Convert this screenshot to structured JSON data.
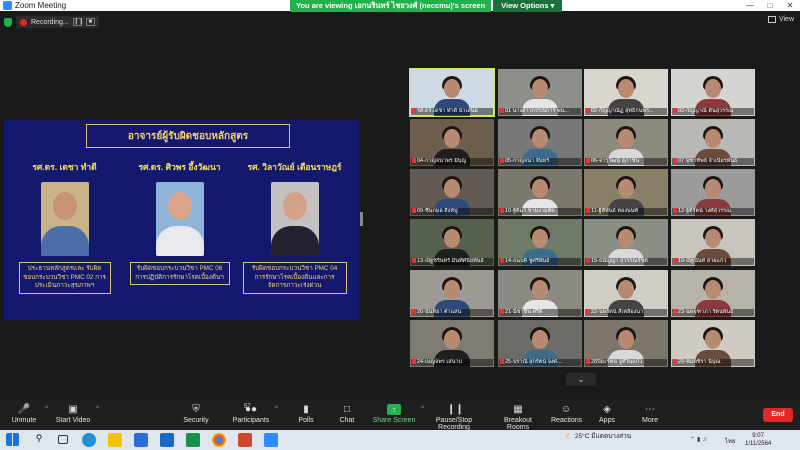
{
  "window": {
    "title": "Zoom Meeting"
  },
  "share_banner": {
    "message": "You are viewing เอกนรินทร์ ไชยวงศ์ (neccmu)'s screen",
    "options_label": "View Options ▾"
  },
  "recording": {
    "label": "Recording..."
  },
  "view_label": "View",
  "slide": {
    "title": "อาจารย์ผู้รับผิดชอบหลักสูตร",
    "professors": [
      {
        "name": "รศ.ดร. เดชา ทำดี",
        "desc": "ประธานหลักสูตรและ รับผิดชอบกระบวนวิชา PMC 02 การประเมินภาวะสุขภาพฯ",
        "shirt": "#4c6ea8",
        "bg": "#c9b48a"
      },
      {
        "name": "รศ.ดร. ศิวพร อึ้งวัฒนา",
        "desc": "รับผิดชอบกระบวนวิชา PMC 06 การปฏิบัติการรักษาโรคเบื้องต้นฯ",
        "shirt": "#e8e8ef",
        "bg": "#8fb4d8"
      },
      {
        "name": "รศ. วิลาวัณย์ เตือนราษฎร์",
        "desc": "รับผิดชอบกระบวนวิชา PMC 04 การรักษาโรคเบื้องต้นและการ จัดการภาวะเร่งด่วน",
        "shirt": "#222233",
        "bg": "#c4c2c0"
      }
    ]
  },
  "participants": [
    {
      "label": "รศ.ดร.เดชา ทำดี นำเสนอ",
      "bg": "#cfd9e4"
    },
    {
      "label": "01 นางสาวกรรณิการ์ พน...",
      "bg": "#8c8f8a"
    },
    {
      "label": "02-กัญญาณัฏ สุทธิกนพร...",
      "bg": "#d8d6cf"
    },
    {
      "label": "03-กัญญาณี ตันสุวรรณ",
      "bg": "#d4d4d0"
    },
    {
      "label": "04-กาญจนาพร มีบุญ",
      "bg": "#6d5d4c"
    },
    {
      "label": "05-กาญจนา จันทร์",
      "bg": "#78787a"
    },
    {
      "label": "06-จารุวัฒน์ สุภาชน",
      "bg": "#8e8a7e"
    },
    {
      "label": "07 จุฑาทิพย์ จำเนียรพันธ์",
      "bg": "#b8b8b4"
    },
    {
      "label": "09-ชื่นกมล สิงห์ปู",
      "bg": "#625a54"
    },
    {
      "label": "10-ฐิติมา ขามงามตัด",
      "bg": "#7d786d"
    },
    {
      "label": "11-ฐิติพันธ์ ทองนนท์",
      "bg": "#877f66"
    },
    {
      "label": "12-ฐิติรัตน์ วงศ์สุวรรณ",
      "bg": "#9b9b9b"
    },
    {
      "label": "13-ณัฐชรินทร์ มันทัศนียพันธ์",
      "bg": "#57624e"
    },
    {
      "label": "14-ธนบดี ชูศรีพันธ์",
      "bg": "#6f7b66"
    },
    {
      "label": "15-ธนัญญา สุวรรณรัชต์",
      "bg": "#8a8f86"
    },
    {
      "label": "19-ณัฐนันท์ สายแก้ว",
      "bg": "#c8c5bf"
    },
    {
      "label": "20-นันทิยา ตำแสน",
      "bg": "#9c9a93"
    },
    {
      "label": "21-นิชาชิน ศรีดี",
      "bg": "#8b8a82"
    },
    {
      "label": "22-นพรัตน์ สีเหลืองนา",
      "bg": "#d0cdc5"
    },
    {
      "label": "23-นพจุฑาภา รัตนพันธ์",
      "bg": "#b7b3aa"
    },
    {
      "label": "24-เบญจพร เสนาป",
      "bg": "#7e7b73"
    },
    {
      "label": "25-ปราณี สุกรัตน์ จงศ...",
      "bg": "#6b6b68"
    },
    {
      "label": "28ปิยะรัตน์ จูที่วิ่นแก้ว",
      "bg": "#7c766c"
    },
    {
      "label": "29-พิมพ์ชิรา นีปุณ",
      "bg": "#cfcac3"
    }
  ],
  "toolbar": {
    "unmute": "Unmute",
    "start_video": "Start Video",
    "security": "Security",
    "participants": "Participants",
    "participants_count": "57",
    "polls": "Polls",
    "chat": "Chat",
    "share_screen": "Share Screen",
    "pause_recording": "Pause/Stop Recording",
    "breakout_rooms": "Breakout Rooms",
    "reactions": "Reactions",
    "apps": "Apps",
    "more": "More",
    "end": "End"
  },
  "taskbar": {
    "temperature": "25°C",
    "weather": "มีแดดบางส่วน",
    "lang": "ไทย",
    "time": "9:07",
    "date": "1/11/2564"
  }
}
